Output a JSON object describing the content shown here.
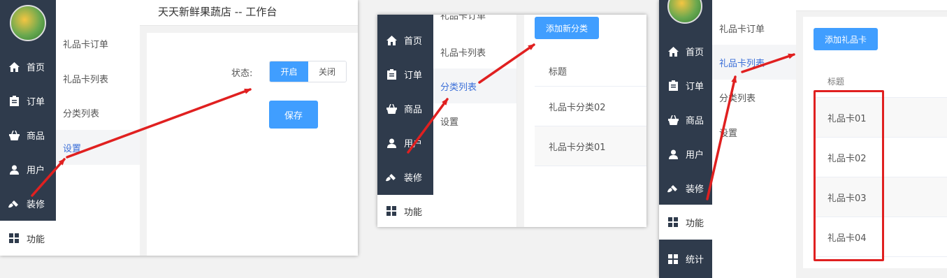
{
  "colors": {
    "nav_bg": "#2f3b4c",
    "primary": "#409eff",
    "active_link": "#3b6fd8",
    "arrow": "#e02020",
    "highlight_box": "#e02020"
  },
  "nav": {
    "home": "首页",
    "orders": "订单",
    "goods": "商品",
    "users": "用户",
    "decor": "装修",
    "features": "功能",
    "stats": "统计"
  },
  "submenu": {
    "giftcard_orders": "礼品卡订单",
    "giftcard_list": "礼品卡列表",
    "category_list": "分类列表",
    "settings": "设置"
  },
  "panel1": {
    "header_title": "天天新鲜果蔬店 -- 工作台",
    "status_label": "状态:",
    "toggle_on": "开启",
    "toggle_off": "关闭",
    "save_button": "保存"
  },
  "panel2": {
    "add_category_button": "添加新分类",
    "column_title": "标题",
    "rows": [
      "礼品卡分类02",
      "礼品卡分类01"
    ]
  },
  "panel3": {
    "add_giftcard_button": "添加礼品卡",
    "column_title": "标题",
    "rows": [
      "礼品卡01",
      "礼品卡02",
      "礼品卡03",
      "礼品卡04"
    ]
  }
}
